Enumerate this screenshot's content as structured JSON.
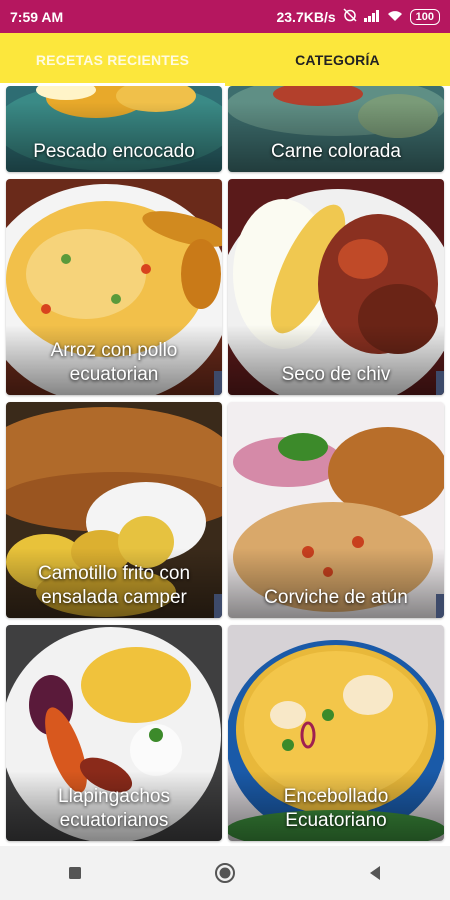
{
  "status_bar": {
    "time": "7:59 AM",
    "network_speed": "23.7KB/s",
    "battery": "100",
    "icons": [
      "alarm-off-icon",
      "signal-icon",
      "wifi-icon",
      "battery-icon"
    ]
  },
  "tabs": [
    {
      "label": "RECETAS RECIENTES",
      "active": true
    },
    {
      "label": "CATEGORÍA",
      "active": false
    }
  ],
  "recipes": [
    {
      "title": "Pescado encocado"
    },
    {
      "title": "Carne colorada"
    },
    {
      "title": "Arroz con pollo ecuatorian"
    },
    {
      "title": "Seco de chiv"
    },
    {
      "title": "Camotillo frito con ensalada camper"
    },
    {
      "title": "Corviche de atún"
    },
    {
      "title": "Llapingachos ecuatorianos"
    },
    {
      "title": "Encebollado Ecuatoriano"
    }
  ],
  "nav": {
    "icons": [
      "recents-square-icon",
      "home-circle-icon",
      "back-triangle-icon"
    ]
  },
  "colors": {
    "status_bar": "#b5175f",
    "tab_bar": "#fce73c",
    "tab_active_text": "#fffbe0"
  }
}
